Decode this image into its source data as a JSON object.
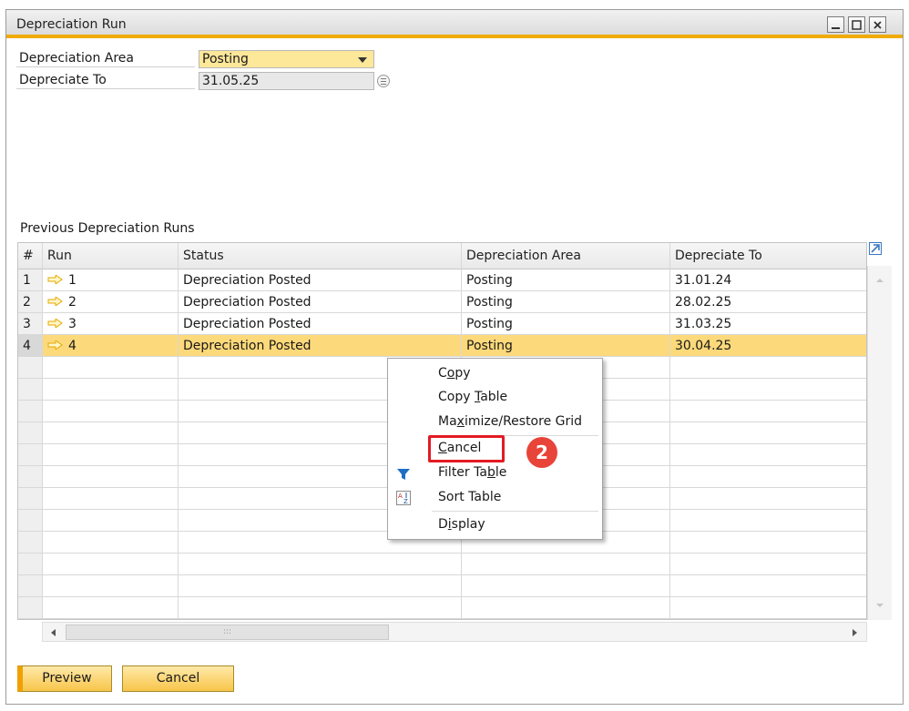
{
  "window": {
    "title": "Depreciation Run"
  },
  "form": {
    "depreciation_area": {
      "label": "Depreciation Area",
      "value": "Posting"
    },
    "depreciate_to": {
      "label": "Depreciate To",
      "value": "31.05.25"
    }
  },
  "grid": {
    "caption": "Previous Depreciation Runs",
    "columns": [
      "#",
      "Run",
      "Status",
      "Depreciation Area",
      "Depreciate To"
    ],
    "rows": [
      {
        "num": "1",
        "run": "1",
        "status": "Depreciation Posted",
        "area": "Posting",
        "date": "31.01.24"
      },
      {
        "num": "2",
        "run": "2",
        "status": "Depreciation Posted",
        "area": "Posting",
        "date": "28.02.25"
      },
      {
        "num": "3",
        "run": "3",
        "status": "Depreciation Posted",
        "area": "Posting",
        "date": "31.03.25"
      },
      {
        "num": "4",
        "run": "4",
        "status": "Depreciation Posted",
        "area": "Posting",
        "date": "30.04.25"
      }
    ],
    "scroll_thumb_grip": ":::"
  },
  "context_menu": {
    "items": [
      {
        "pre": "C",
        "u": "o",
        "post": "py"
      },
      {
        "pre": "Copy ",
        "u": "T",
        "post": "able"
      },
      {
        "pre": "Ma",
        "u": "x",
        "post": "imize/Restore Grid"
      },
      {
        "pre": "",
        "u": "C",
        "post": "ancel"
      },
      {
        "pre": "Filter Ta",
        "u": "b",
        "post": "le"
      },
      {
        "pre": "Sort Table",
        "u": "",
        "post": ""
      },
      {
        "pre": "D",
        "u": "i",
        "post": "splay"
      }
    ]
  },
  "annotation": {
    "step": "2",
    "color": "#e31b23"
  },
  "buttons": {
    "preview": "Preview",
    "cancel": "Cancel"
  },
  "colors": {
    "accent": "#f0ab00",
    "selected_row": "#fcd97a",
    "field_highlight": "#fde799"
  }
}
